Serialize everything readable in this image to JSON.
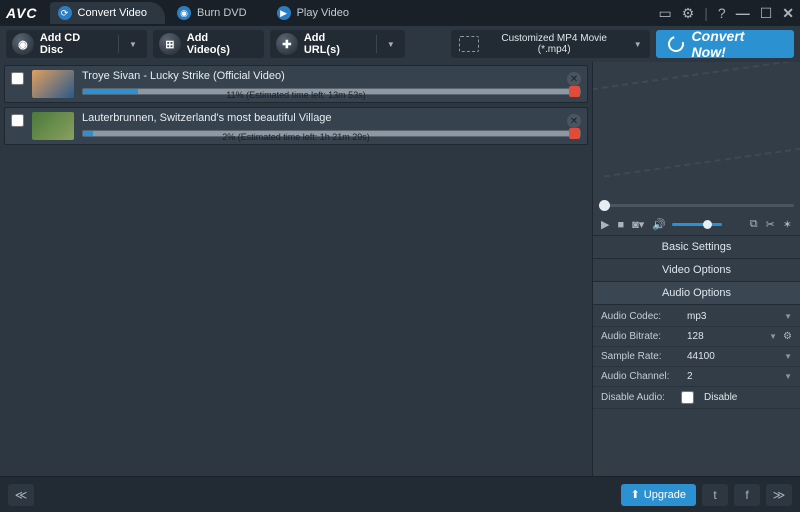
{
  "app": {
    "logo": "AVC"
  },
  "tabs": [
    {
      "label": "Convert Video",
      "active": true
    },
    {
      "label": "Burn DVD",
      "active": false
    },
    {
      "label": "Play Video",
      "active": false
    }
  ],
  "toolbar": {
    "add_cd": "Add CD Disc",
    "add_videos": "Add Video(s)",
    "add_urls": "Add URL(s)"
  },
  "profile": {
    "label": "Customized MP4 Movie (*.mp4)"
  },
  "convert_label": "Convert Now!",
  "items": [
    {
      "title": "Troye Sivan - Lucky Strike (Official Video)",
      "percent": 11,
      "status": "11% (Estimated time left: 13m 53s)"
    },
    {
      "title": "Lauterbrunnen, Switzerland's most beautiful Village",
      "percent": 2,
      "status": "2% (Estimated time left: 1h 21m 29s)"
    }
  ],
  "settings_tabs": {
    "basic": "Basic Settings",
    "video": "Video Options",
    "audio": "Audio Options"
  },
  "audio_settings": {
    "codec": {
      "label": "Audio Codec:",
      "value": "mp3"
    },
    "bitrate": {
      "label": "Audio Bitrate:",
      "value": "128"
    },
    "sample": {
      "label": "Sample Rate:",
      "value": "44100"
    },
    "channel": {
      "label": "Audio Channel:",
      "value": "2"
    },
    "disable": {
      "label": "Disable Audio:",
      "value": "Disable"
    }
  },
  "footer": {
    "upgrade": "Upgrade"
  }
}
